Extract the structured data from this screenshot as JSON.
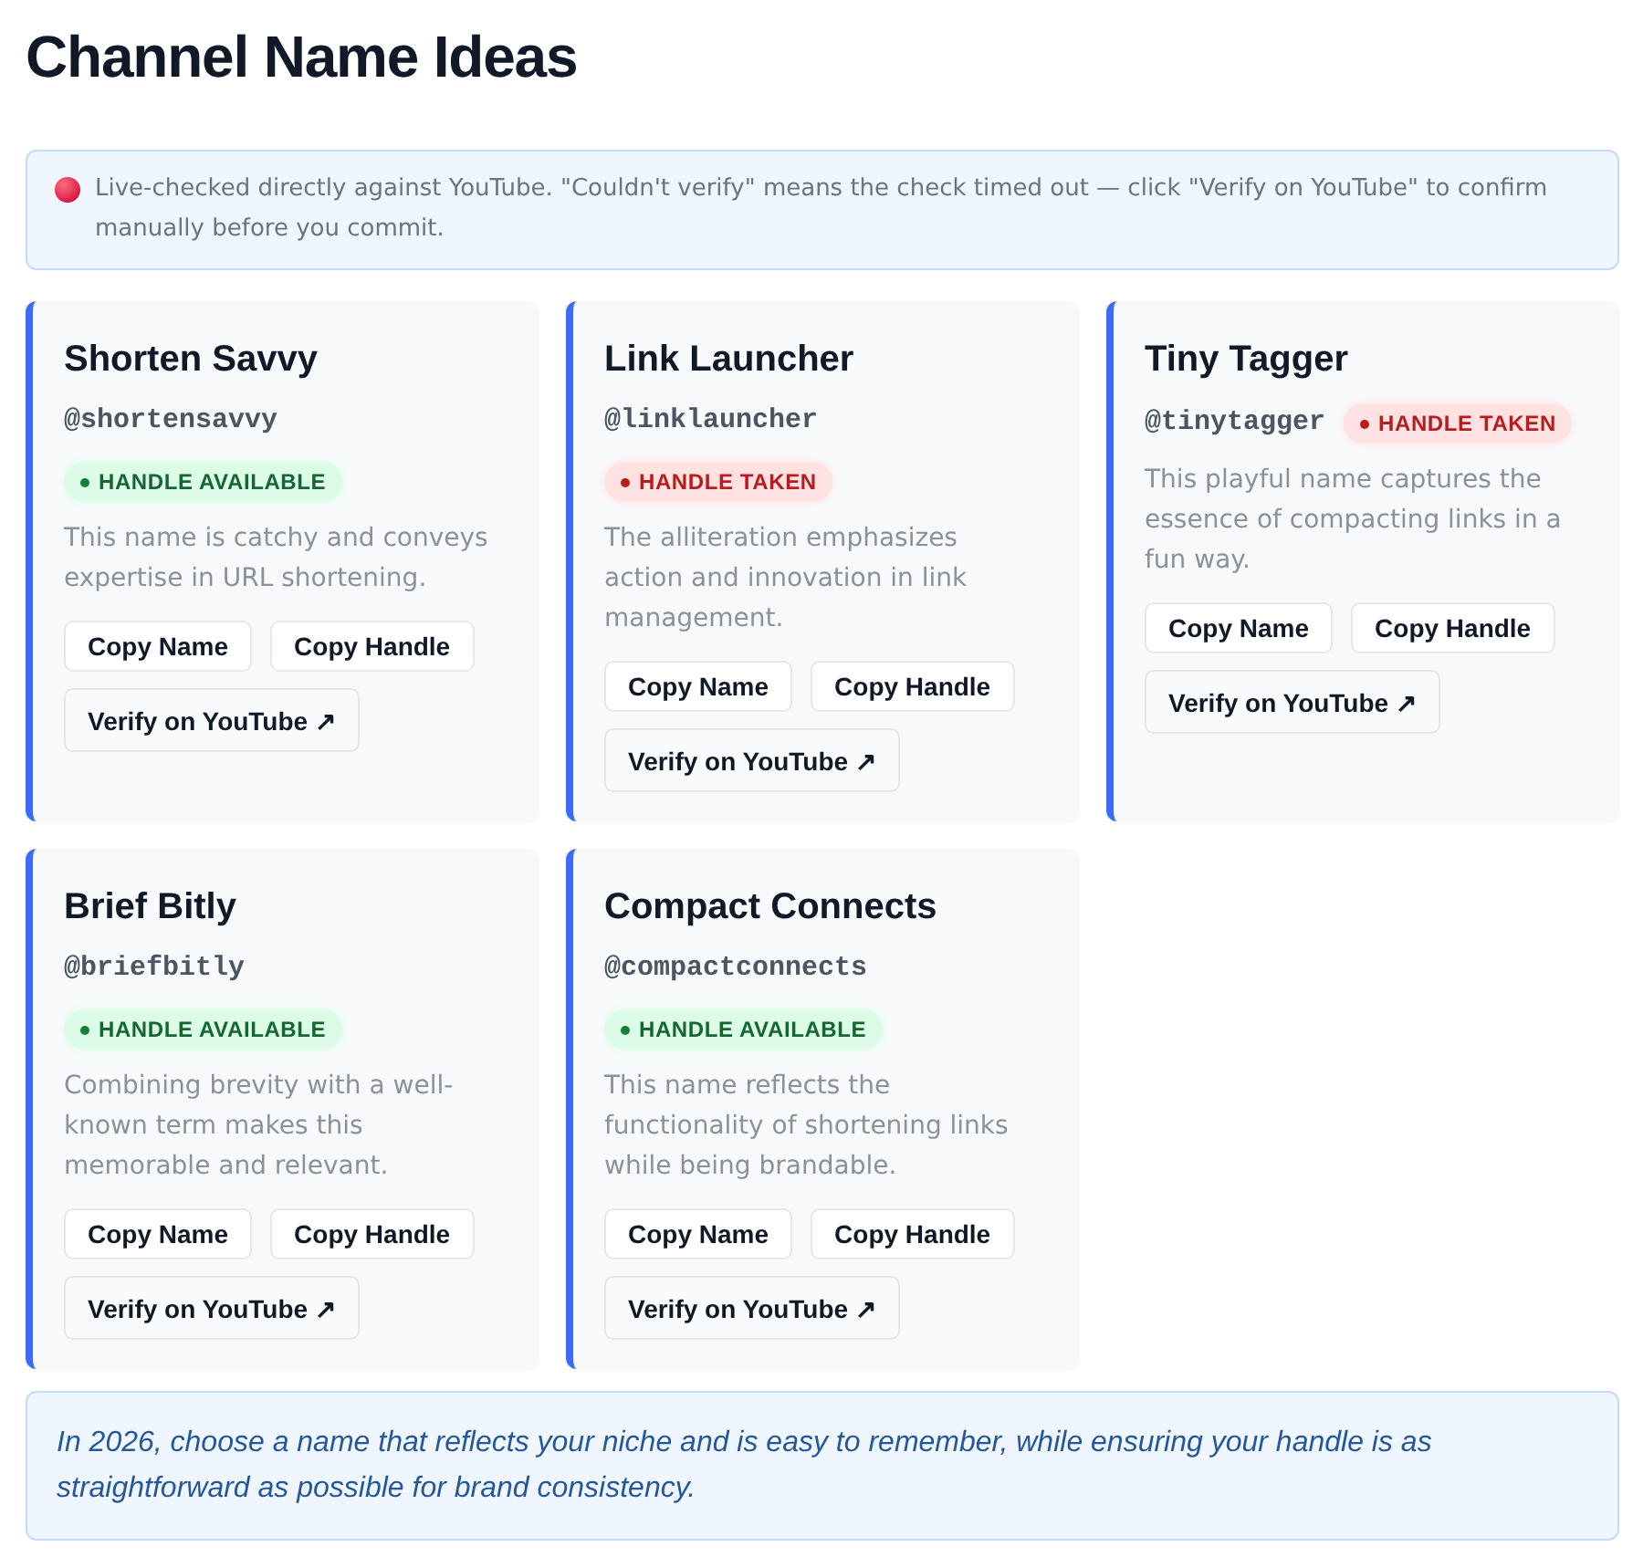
{
  "title": "Channel Name Ideas",
  "notice": {
    "text": "Live-checked directly against YouTube. \"Couldn't verify\" means the check timed out — click \"Verify on YouTube\" to confirm manually before you commit."
  },
  "ideas": [
    {
      "name": "Shorten Savvy",
      "handle": "@shortensavvy",
      "badge": {
        "kind": "available",
        "label": "HANDLE AVAILABLE"
      },
      "description": "This name is catchy and conveys expertise in URL shortening.",
      "buttons": [
        {
          "label": "Copy Name",
          "kind": "copy"
        },
        {
          "label": "Copy Handle",
          "kind": "copy"
        },
        {
          "label": "Verify on YouTube ↗",
          "kind": "link"
        }
      ]
    },
    {
      "name": "Link Launcher",
      "handle": "@linklauncher",
      "badge": {
        "kind": "taken",
        "label": "HANDLE TAKEN"
      },
      "description": "The alliteration emphasizes action and innovation in link management.",
      "buttons": [
        {
          "label": "Copy Name",
          "kind": "copy"
        },
        {
          "label": "Copy Handle",
          "kind": "copy"
        },
        {
          "label": "Verify on YouTube ↗",
          "kind": "link"
        }
      ]
    },
    {
      "name": "Tiny Tagger",
      "handle": "@tinytagger",
      "badge": {
        "kind": "taken",
        "label": "HANDLE TAKEN"
      },
      "description": "This playful name captures the essence of compacting links in a fun way.",
      "buttons": [
        {
          "label": "Copy Name",
          "kind": "copy"
        },
        {
          "label": "Copy Handle",
          "kind": "copy"
        },
        {
          "label": "Verify on YouTube ↗",
          "kind": "link"
        }
      ]
    },
    {
      "name": "Brief Bitly",
      "handle": "@briefbitly",
      "badge": {
        "kind": "available",
        "label": "HANDLE AVAILABLE"
      },
      "description": "Combining brevity with a well-known term makes this memorable and relevant.",
      "buttons": [
        {
          "label": "Copy Name",
          "kind": "copy"
        },
        {
          "label": "Copy Handle",
          "kind": "copy"
        },
        {
          "label": "Verify on YouTube ↗",
          "kind": "link"
        }
      ]
    },
    {
      "name": "Compact Connects",
      "handle": "@compactconnects",
      "badge": {
        "kind": "available",
        "label": "HANDLE AVAILABLE"
      },
      "description": "This name reflects the functionality of shortening links while being brandable.",
      "buttons": [
        {
          "label": "Copy Name",
          "kind": "copy"
        },
        {
          "label": "Copy Handle",
          "kind": "copy"
        },
        {
          "label": "Verify on YouTube ↗",
          "kind": "link"
        }
      ]
    }
  ],
  "tip": {
    "text": "In 2026, choose a name that reflects your niche and is easy to remember, while ensuring your handle is as straightforward as possible for brand consistency."
  }
}
